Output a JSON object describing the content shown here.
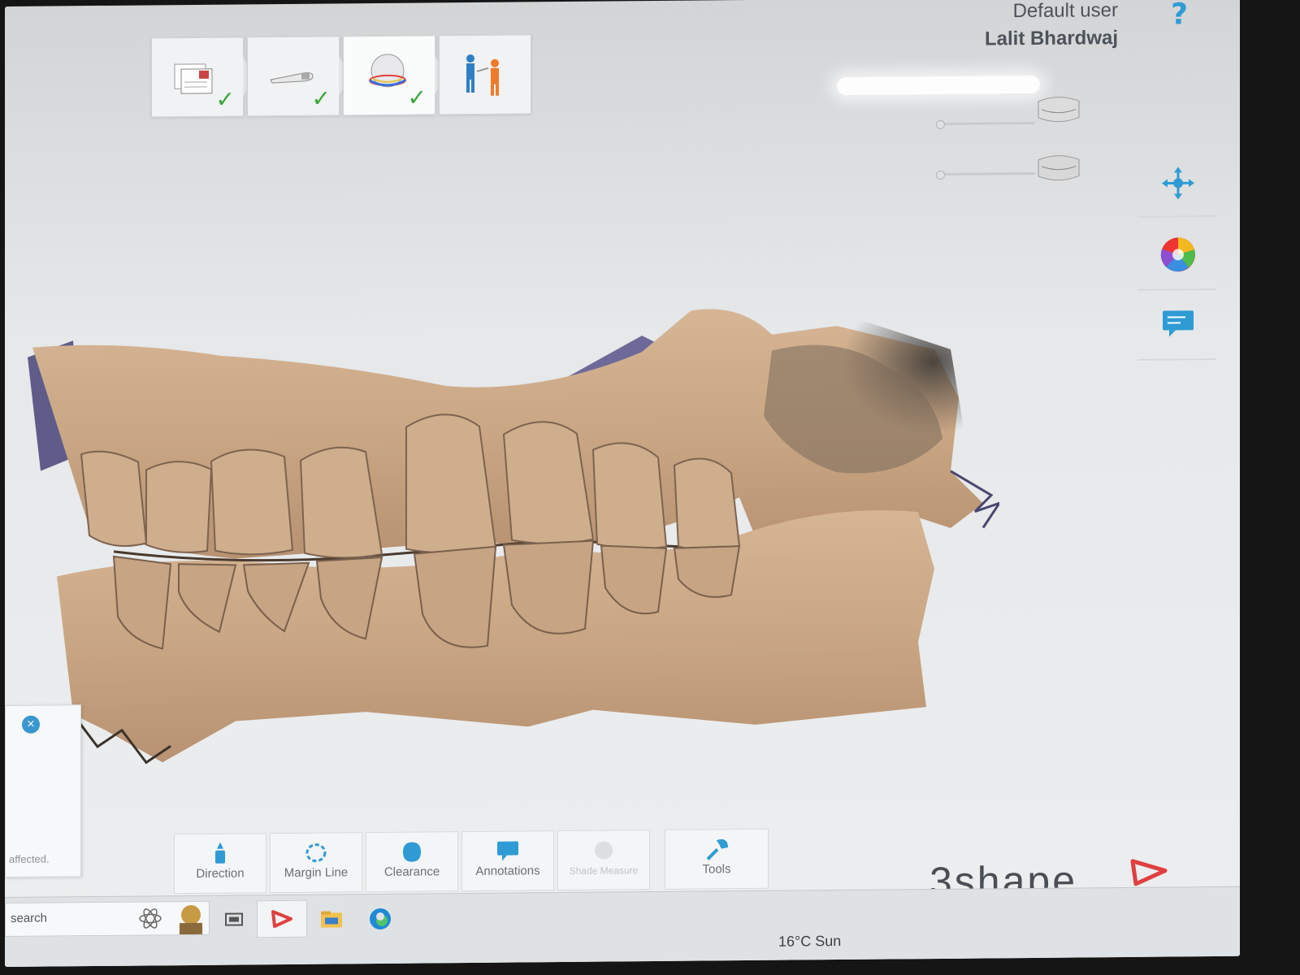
{
  "user": {
    "role": "Default user",
    "name": "Lalit Bhardwaj",
    "help": "?"
  },
  "workflow": [
    {
      "name": "order-form",
      "done": true,
      "check": "✓"
    },
    {
      "name": "scanner",
      "done": true,
      "check": "✓"
    },
    {
      "name": "post-processing",
      "done": true,
      "check": "✓"
    },
    {
      "name": "send-to-lab",
      "done": false,
      "check": ""
    }
  ],
  "right_toolbar": [
    "move-icon",
    "color-wheel-icon",
    "comment-icon"
  ],
  "bottom_toolbar": [
    {
      "label": "Direction",
      "icon": "direction-icon"
    },
    {
      "label": "Margin Line",
      "icon": "margin-line-icon"
    },
    {
      "label": "Clearance",
      "icon": "clearance-icon"
    },
    {
      "label": "Annotations",
      "icon": "annotations-icon"
    },
    {
      "label": "Shade Measure",
      "icon": "shade-measure-icon",
      "disabled": true
    }
  ],
  "tools": {
    "label": "Tools",
    "icon": "wrench-icon"
  },
  "side_panel": {
    "close": "×",
    "text": "affected."
  },
  "logo": "3shape",
  "taskbar": {
    "search_placeholder": "search",
    "weather": "16°C  Sun"
  },
  "colors": {
    "accent": "#2f9bd4",
    "check": "#3aa53a",
    "scan_tan": "#c9a98a",
    "scan_purple": "#6d6a9a"
  }
}
